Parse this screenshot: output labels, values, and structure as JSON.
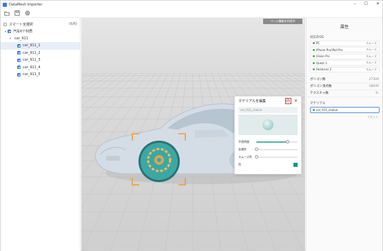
{
  "app": {
    "title": "DataMesh Importer"
  },
  "window_controls": [
    "minimize-icon",
    "maximize-icon",
    "close-icon"
  ],
  "toolbar": [
    "open-folder-icon",
    "save-icon",
    "settings-icon"
  ],
  "left_panel": {
    "smart_select_label": "スマート全選択",
    "smart_select_count": "(6/6)",
    "tree": [
      {
        "label": "汽车6个材质",
        "level": 0,
        "checked": true,
        "caret": "▾"
      },
      {
        "label": "car_911",
        "level": 1,
        "checked": null,
        "caret": "▾"
      },
      {
        "label": "car_911_1",
        "level": 2,
        "checked": true,
        "caret": "",
        "selected": true
      },
      {
        "label": "car_911_2",
        "level": 2,
        "checked": true,
        "caret": ""
      },
      {
        "label": "car_911_3",
        "level": 2,
        "checked": true,
        "caret": ""
      },
      {
        "label": "car_911_4",
        "level": 2,
        "checked": true,
        "caret": ""
      },
      {
        "label": "car_911_5",
        "level": 2,
        "checked": true,
        "caret": ""
      }
    ]
  },
  "viewport": {
    "mode_button": "ページ機能を利用中"
  },
  "right_panel": {
    "title": "属性",
    "os_section": "対応のOS",
    "os_list": [
      {
        "name": "PC",
        "status": "スムーズ"
      },
      {
        "name": "iPhone Pro/iPad Pro",
        "status": "スムーズ"
      },
      {
        "name": "Vision Pro",
        "status": "スムーズ"
      },
      {
        "name": "Quest 3",
        "status": "スムーズ"
      },
      {
        "name": "HoloLens 2",
        "status": "スムーズ"
      }
    ],
    "stats": [
      {
        "label": "ポリゴン数",
        "value": "27309"
      },
      {
        "label": "ポリゴン頂点数",
        "value": "18049"
      },
      {
        "label": "テクスチャ数",
        "value": "0"
      }
    ],
    "material_section": "マテリアル",
    "material_value": "car_911_chelun",
    "reset_label": "リセット"
  },
  "material_dialog": {
    "title": "マテリアルを編集",
    "name": "car_911_chelun",
    "props": [
      {
        "label": "不透明度",
        "level": 0.75
      },
      {
        "label": "金属性",
        "level": 0.0
      },
      {
        "label": "スムーズ性",
        "level": 0.0
      }
    ],
    "color_label": "色",
    "color": "#1f8f8c"
  },
  "colors": {
    "accent": "#3a7bd5",
    "status_green": "#3cb043",
    "highlight_orange": "#f39a2b",
    "wheel_teal": "#3ea7a3"
  }
}
